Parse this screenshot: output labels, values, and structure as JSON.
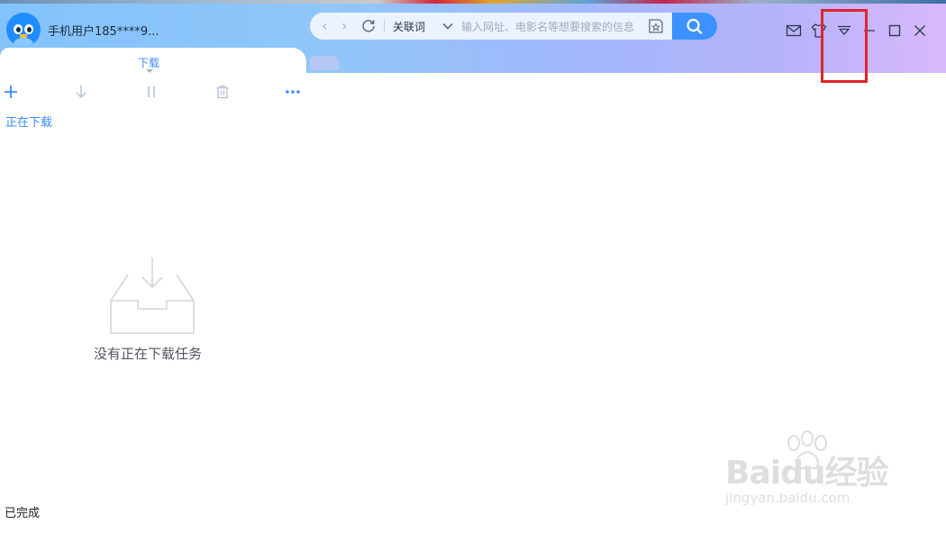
{
  "window": {
    "username": "手机用户185****9...",
    "search": {
      "keyword_label": "关联词",
      "placeholder": "输入网址、电影名等想要搜索的信息"
    },
    "tabs": [
      {
        "label": "下载",
        "active": true
      }
    ]
  },
  "toolbar": {
    "icons": [
      "add-icon",
      "download-icon",
      "pause-icon",
      "delete-icon",
      "more-icon"
    ]
  },
  "main": {
    "section_label": "正在下载",
    "empty_message": "没有正在下载任务",
    "completed_label": "已完成"
  },
  "watermark": {
    "brand": "Baidu经验",
    "url": "jingyan.baidu.com"
  },
  "colors": {
    "accent": "#3a8bff",
    "search_button": "#3c93ff",
    "highlight": "#e0242b"
  }
}
